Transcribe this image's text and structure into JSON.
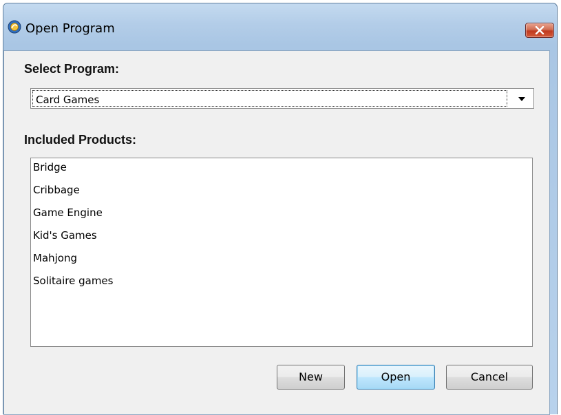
{
  "window": {
    "title": "Open Program",
    "close_label": "Close"
  },
  "select_program": {
    "label": "Select Program:",
    "selected_value": "Card Games"
  },
  "included_products": {
    "label": "Included Products:",
    "items": [
      "Bridge",
      "Cribbage",
      "Game Engine",
      "Kid's Games",
      "Mahjong",
      "Solitaire games"
    ]
  },
  "buttons": {
    "new_label": "New",
    "open_label": "Open",
    "cancel_label": "Cancel"
  },
  "icons": {
    "app": "program-icon",
    "close": "close-icon",
    "dropdown": "chevron-down-icon"
  },
  "colors": {
    "title_bar": "#b3cde8",
    "close_button": "#c0391f",
    "dialog_background": "#f0f0f0",
    "default_button": "#bee6fd"
  }
}
